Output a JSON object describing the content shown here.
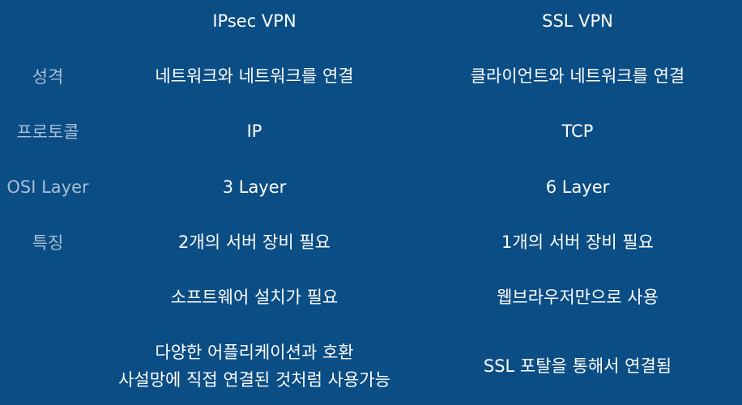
{
  "headers": {
    "col1": "IPsec VPN",
    "col2": "SSL VPN"
  },
  "rows": [
    {
      "label": "성격",
      "col1": "네트워크와 네트워크를 연결",
      "col2": "클라이언트와 네트워크를 연결"
    },
    {
      "label": "프로토콜",
      "col1": "IP",
      "col2": "TCP"
    },
    {
      "label": "OSI Layer",
      "col1": "3 Layer",
      "col2": "6 Layer"
    },
    {
      "label": "특징",
      "col1": "2개의 서버 장비 필요",
      "col2": "1개의 서버 장비 필요"
    },
    {
      "label": "",
      "col1": "소프트웨어 설치가 필요",
      "col2": "웹브라우저만으로 사용"
    },
    {
      "label": "",
      "col1_line1": "다양한 어플리케이션과 호환",
      "col1_line2": "사설망에 직접 연결된 것처럼 사용가능",
      "col2": "SSL 포탈을 통해서 연결됨"
    }
  ]
}
